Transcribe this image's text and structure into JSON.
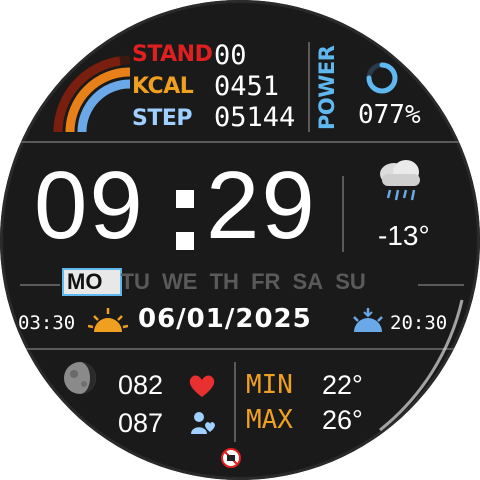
{
  "colors": {
    "background": "#1a1a1a",
    "stand": "#e02020",
    "kcal": "#f0a020",
    "step": "#9fd0ff",
    "power": "#60b8f0",
    "label_orange": "#f0a020",
    "heart": "#e83030",
    "divider": "#5a5a5a"
  },
  "activity": {
    "stand_label": "STAND",
    "stand_value": "00",
    "kcal_label": "KCAL",
    "kcal_value": "0451",
    "step_label": "STEP",
    "step_value": "05144",
    "arc_icon": "activity-rings-icon"
  },
  "battery": {
    "label": "POWER",
    "percent_text": "077%",
    "level": 0.77,
    "icon": "battery-ring-icon"
  },
  "time": {
    "hours": "09",
    "minutes": "29"
  },
  "weather": {
    "icon": "rain-cloud-icon",
    "temperature": "-13°"
  },
  "weekdays": {
    "days": [
      "MO",
      "TU",
      "WE",
      "TH",
      "FR",
      "SA",
      "SU"
    ],
    "active_index": 0
  },
  "sun": {
    "sunrise": "03:30",
    "sunrise_icon": "sunrise-icon",
    "date": "06/01/2025",
    "sunset_icon": "sunset-icon",
    "sunset": "20:30"
  },
  "health": {
    "moon_icon": "moon-phase-icon",
    "heart_rate": "082",
    "heart_icon": "heart-icon",
    "second_value": "087",
    "person_icon": "person-heart-icon"
  },
  "temps": {
    "min_label": "MIN",
    "min_value": "22°",
    "max_label": "MAX",
    "max_value": "26°"
  },
  "status": {
    "icon": "disconnected-icon"
  }
}
